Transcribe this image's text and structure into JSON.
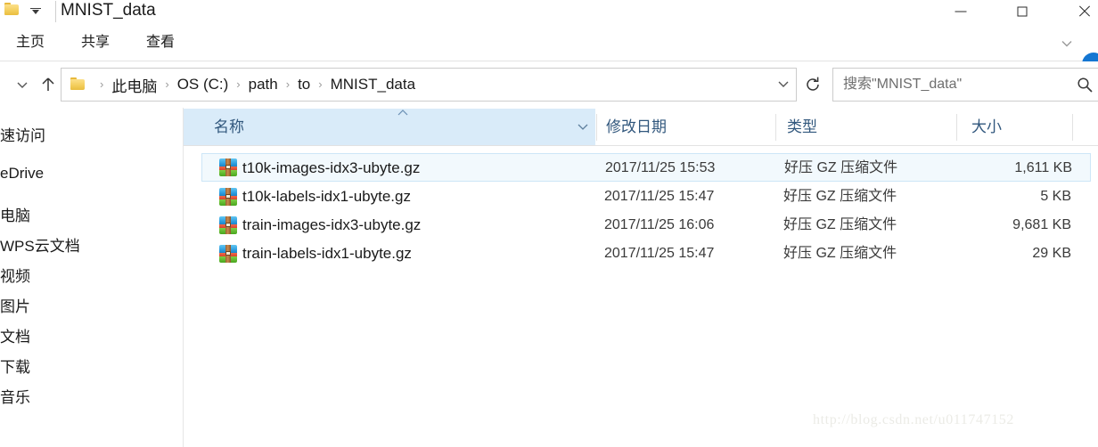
{
  "window": {
    "title": "MNIST_data",
    "quick_access_icon": "folder-icon",
    "quick_access_dropdown_icon": "customize-quick-access-toolbar-icon",
    "controls": {
      "minimize_icon": "minimize-icon",
      "maximize_icon": "maximize-icon",
      "close_icon": "close-icon"
    }
  },
  "ribbon": {
    "tabs": [
      {
        "label": "主页"
      },
      {
        "label": "共享"
      },
      {
        "label": "查看"
      }
    ],
    "collapse_icon": "chevron-down-icon",
    "help_icon": "help-circle-icon"
  },
  "toolbar": {
    "recent_locations_icon": "chevron-down-icon",
    "up_icon": "arrow-up-icon",
    "address_folder_icon": "folder-icon",
    "breadcrumbs": [
      {
        "label": "此电脑"
      },
      {
        "label": "OS (C:)"
      },
      {
        "label": "path"
      },
      {
        "label": "to"
      },
      {
        "label": "MNIST_data"
      }
    ],
    "breadcrumb_separator": "›",
    "address_dropdown_icon": "chevron-down-icon",
    "refresh_icon": "refresh-icon"
  },
  "search": {
    "placeholder": "搜索\"MNIST_data\"",
    "value": "",
    "icon": "search-icon"
  },
  "navpane": {
    "items": [
      {
        "label": "速访问"
      },
      {
        "label": "eDrive"
      },
      {
        "label": "电脑"
      },
      {
        "label": "WPS云文档"
      },
      {
        "label": "视频"
      },
      {
        "label": "图片"
      },
      {
        "label": "文档"
      },
      {
        "label": "下载"
      },
      {
        "label": "音乐"
      }
    ]
  },
  "filelist": {
    "columns": [
      {
        "label": "名称",
        "sorted": "asc",
        "sort_icon": "caret-up-icon",
        "filter_icon": "chevron-down-icon"
      },
      {
        "label": "修改日期"
      },
      {
        "label": "类型"
      },
      {
        "label": "大小"
      }
    ],
    "rows": [
      {
        "icon": "archive-file-icon",
        "name": "t10k-images-idx3-ubyte.gz",
        "date": "2017/11/25 15:53",
        "type": "好压 GZ 压缩文件",
        "size": "1,611 KB",
        "hovered": true
      },
      {
        "icon": "archive-file-icon",
        "name": "t10k-labels-idx1-ubyte.gz",
        "date": "2017/11/25 15:47",
        "type": "好压 GZ 压缩文件",
        "size": "5 KB",
        "hovered": false
      },
      {
        "icon": "archive-file-icon",
        "name": "train-images-idx3-ubyte.gz",
        "date": "2017/11/25 16:06",
        "type": "好压 GZ 压缩文件",
        "size": "9,681 KB",
        "hovered": false
      },
      {
        "icon": "archive-file-icon",
        "name": "train-labels-idx1-ubyte.gz",
        "date": "2017/11/25 15:47",
        "type": "好压 GZ 压缩文件",
        "size": "29 KB",
        "hovered": false
      }
    ]
  },
  "watermark": {
    "text": "http://blog.csdn.net/u011747152"
  },
  "colors": {
    "column_header_highlight": "#d9ebf9",
    "column_header_text": "#31577d",
    "row_hover_fill": "#f2f9fd",
    "row_hover_border": "#cde6f7",
    "help_button": "#1476d2",
    "folder_yellow": "#f4cf5e"
  }
}
